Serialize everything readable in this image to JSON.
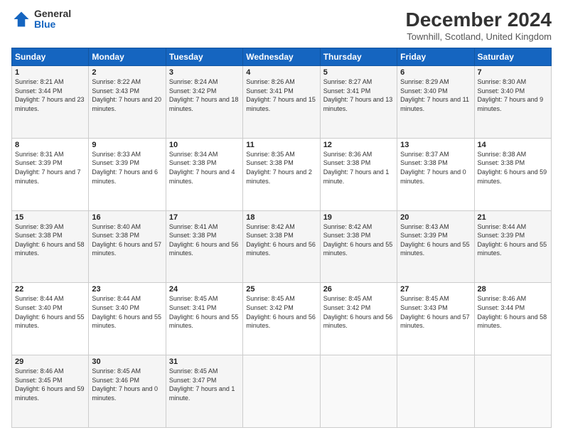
{
  "logo": {
    "general": "General",
    "blue": "Blue"
  },
  "title": "December 2024",
  "location": "Townhill, Scotland, United Kingdom",
  "days_header": [
    "Sunday",
    "Monday",
    "Tuesday",
    "Wednesday",
    "Thursday",
    "Friday",
    "Saturday"
  ],
  "weeks": [
    [
      {
        "day": "1",
        "sunrise": "8:21 AM",
        "sunset": "3:44 PM",
        "daylight": "7 hours and 23 minutes."
      },
      {
        "day": "2",
        "sunrise": "8:22 AM",
        "sunset": "3:43 PM",
        "daylight": "7 hours and 20 minutes."
      },
      {
        "day": "3",
        "sunrise": "8:24 AM",
        "sunset": "3:42 PM",
        "daylight": "7 hours and 18 minutes."
      },
      {
        "day": "4",
        "sunrise": "8:26 AM",
        "sunset": "3:41 PM",
        "daylight": "7 hours and 15 minutes."
      },
      {
        "day": "5",
        "sunrise": "8:27 AM",
        "sunset": "3:41 PM",
        "daylight": "7 hours and 13 minutes."
      },
      {
        "day": "6",
        "sunrise": "8:29 AM",
        "sunset": "3:40 PM",
        "daylight": "7 hours and 11 minutes."
      },
      {
        "day": "7",
        "sunrise": "8:30 AM",
        "sunset": "3:40 PM",
        "daylight": "7 hours and 9 minutes."
      }
    ],
    [
      {
        "day": "8",
        "sunrise": "8:31 AM",
        "sunset": "3:39 PM",
        "daylight": "7 hours and 7 minutes."
      },
      {
        "day": "9",
        "sunrise": "8:33 AM",
        "sunset": "3:39 PM",
        "daylight": "7 hours and 6 minutes."
      },
      {
        "day": "10",
        "sunrise": "8:34 AM",
        "sunset": "3:38 PM",
        "daylight": "7 hours and 4 minutes."
      },
      {
        "day": "11",
        "sunrise": "8:35 AM",
        "sunset": "3:38 PM",
        "daylight": "7 hours and 2 minutes."
      },
      {
        "day": "12",
        "sunrise": "8:36 AM",
        "sunset": "3:38 PM",
        "daylight": "7 hours and 1 minute."
      },
      {
        "day": "13",
        "sunrise": "8:37 AM",
        "sunset": "3:38 PM",
        "daylight": "7 hours and 0 minutes."
      },
      {
        "day": "14",
        "sunrise": "8:38 AM",
        "sunset": "3:38 PM",
        "daylight": "6 hours and 59 minutes."
      }
    ],
    [
      {
        "day": "15",
        "sunrise": "8:39 AM",
        "sunset": "3:38 PM",
        "daylight": "6 hours and 58 minutes."
      },
      {
        "day": "16",
        "sunrise": "8:40 AM",
        "sunset": "3:38 PM",
        "daylight": "6 hours and 57 minutes."
      },
      {
        "day": "17",
        "sunrise": "8:41 AM",
        "sunset": "3:38 PM",
        "daylight": "6 hours and 56 minutes."
      },
      {
        "day": "18",
        "sunrise": "8:42 AM",
        "sunset": "3:38 PM",
        "daylight": "6 hours and 56 minutes."
      },
      {
        "day": "19",
        "sunrise": "8:42 AM",
        "sunset": "3:38 PM",
        "daylight": "6 hours and 55 minutes."
      },
      {
        "day": "20",
        "sunrise": "8:43 AM",
        "sunset": "3:39 PM",
        "daylight": "6 hours and 55 minutes."
      },
      {
        "day": "21",
        "sunrise": "8:44 AM",
        "sunset": "3:39 PM",
        "daylight": "6 hours and 55 minutes."
      }
    ],
    [
      {
        "day": "22",
        "sunrise": "8:44 AM",
        "sunset": "3:40 PM",
        "daylight": "6 hours and 55 minutes."
      },
      {
        "day": "23",
        "sunrise": "8:44 AM",
        "sunset": "3:40 PM",
        "daylight": "6 hours and 55 minutes."
      },
      {
        "day": "24",
        "sunrise": "8:45 AM",
        "sunset": "3:41 PM",
        "daylight": "6 hours and 55 minutes."
      },
      {
        "day": "25",
        "sunrise": "8:45 AM",
        "sunset": "3:42 PM",
        "daylight": "6 hours and 56 minutes."
      },
      {
        "day": "26",
        "sunrise": "8:45 AM",
        "sunset": "3:42 PM",
        "daylight": "6 hours and 56 minutes."
      },
      {
        "day": "27",
        "sunrise": "8:45 AM",
        "sunset": "3:43 PM",
        "daylight": "6 hours and 57 minutes."
      },
      {
        "day": "28",
        "sunrise": "8:46 AM",
        "sunset": "3:44 PM",
        "daylight": "6 hours and 58 minutes."
      }
    ],
    [
      {
        "day": "29",
        "sunrise": "8:46 AM",
        "sunset": "3:45 PM",
        "daylight": "6 hours and 59 minutes."
      },
      {
        "day": "30",
        "sunrise": "8:45 AM",
        "sunset": "3:46 PM",
        "daylight": "7 hours and 0 minutes."
      },
      {
        "day": "31",
        "sunrise": "8:45 AM",
        "sunset": "3:47 PM",
        "daylight": "7 hours and 1 minute."
      },
      null,
      null,
      null,
      null
    ]
  ]
}
